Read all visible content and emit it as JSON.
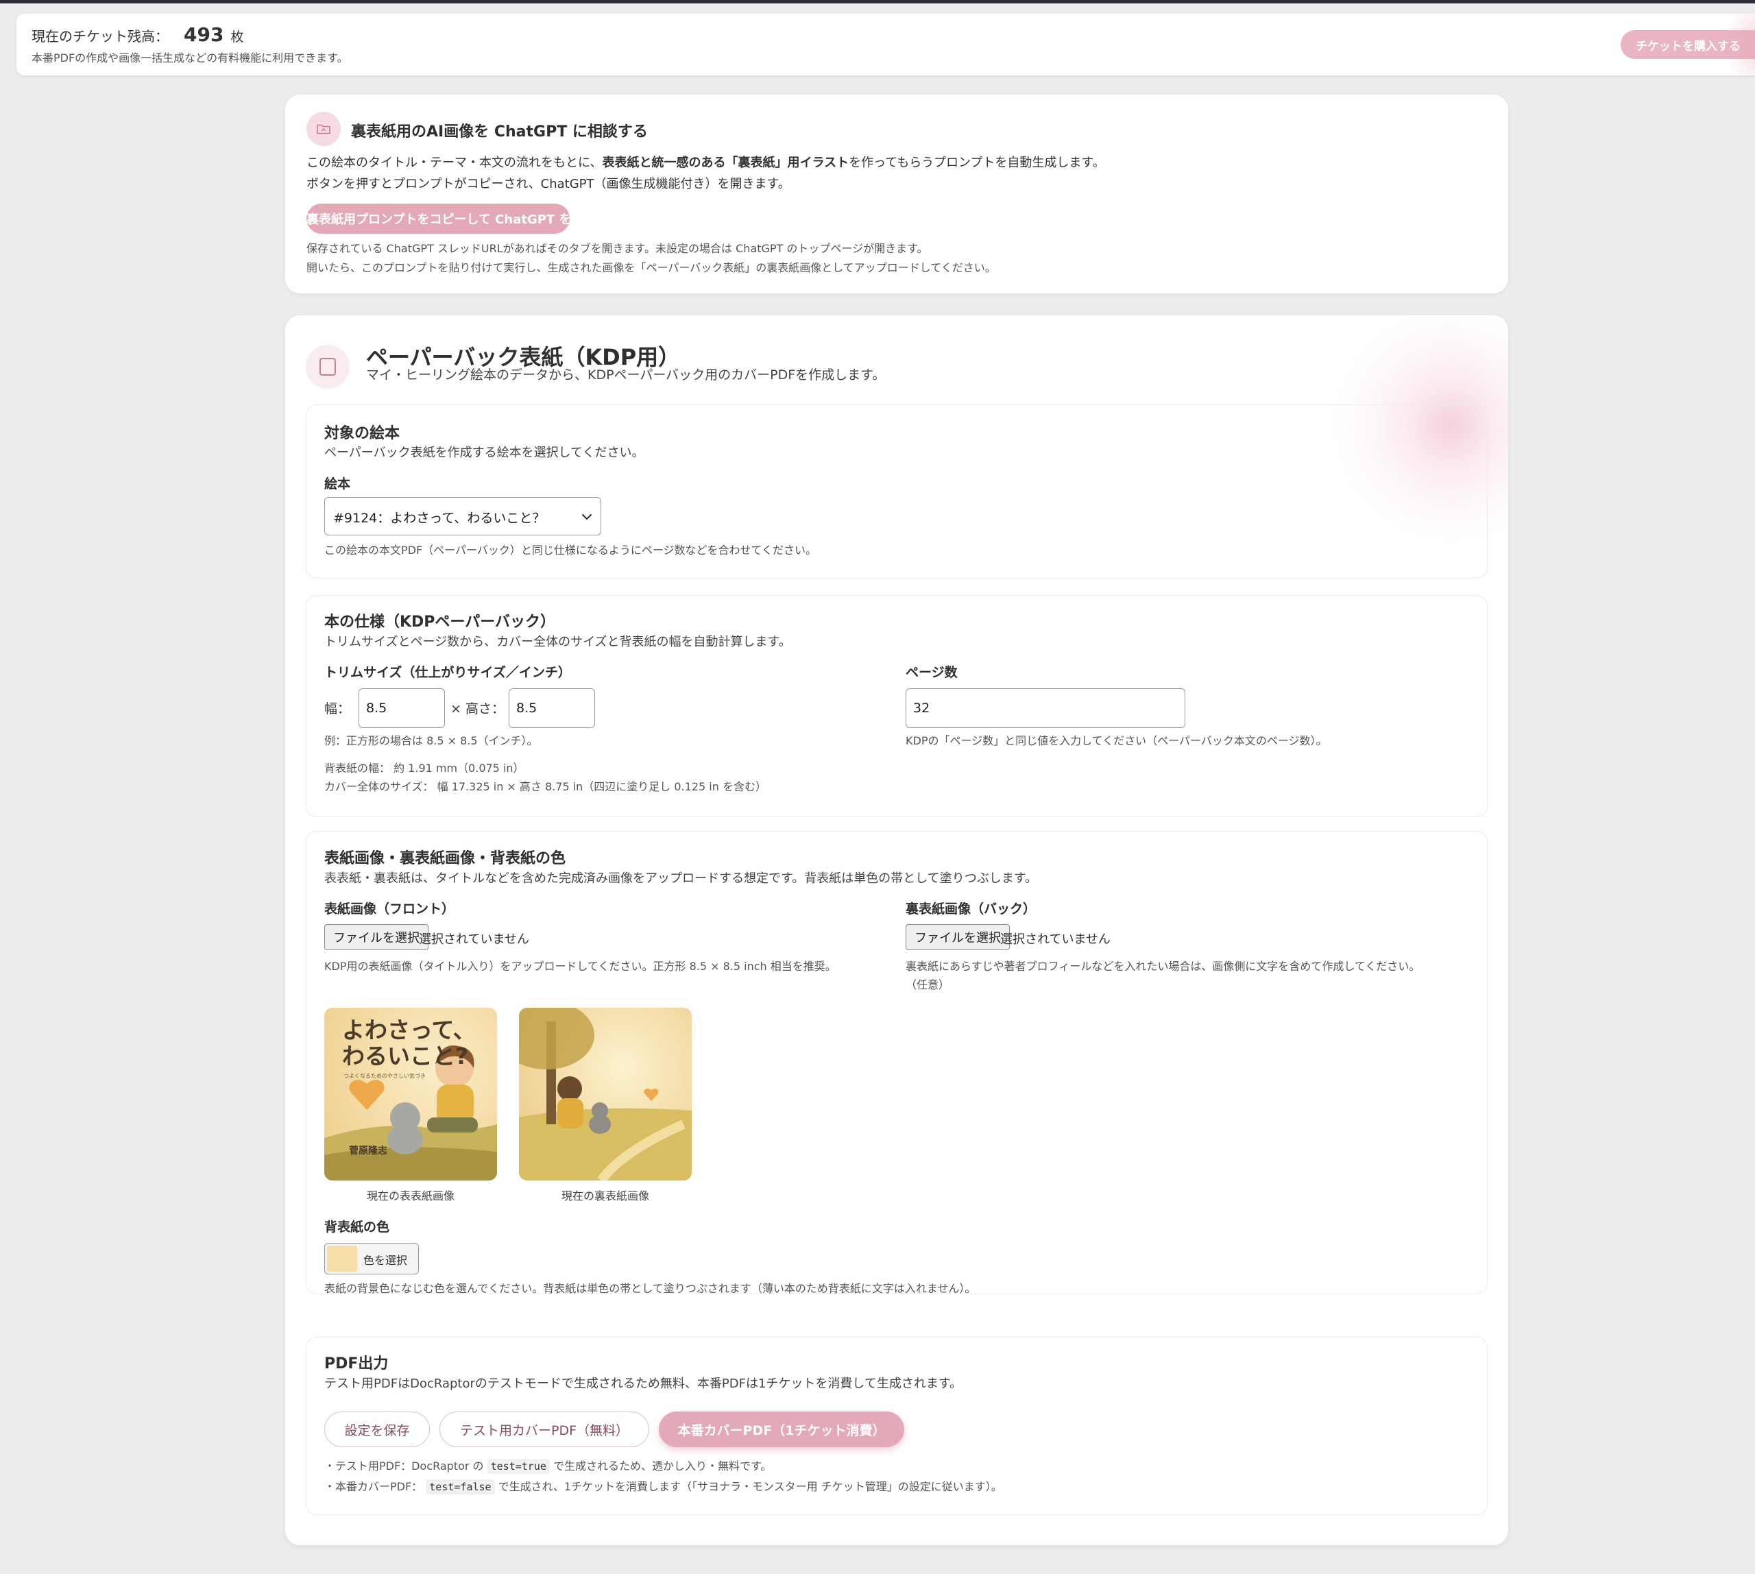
{
  "ticket": {
    "label": "現在のチケット残高：",
    "count": "493",
    "unit": "枚",
    "description": "本番PDFの作成や画像一括生成などの有料機能に利用できます。",
    "buy_button": "チケットを購入する"
  },
  "ai_card": {
    "icon": "folder-image-icon",
    "title": "裏表紙用のAI画像を ChatGPT に相談する",
    "desc_1a": "この絵本のタイトル・テーマ・本文の流れをもとに、",
    "desc_1b": "表表紙と統一感のある「裏表紙」用イラスト",
    "desc_1c": "を作ってもらうプロンプトを自動生成します。",
    "desc_2": "ボタンを押すとプロンプトがコピーされ、ChatGPT（画像生成機能付き）を開きます。",
    "button": "裏表紙用プロンプトをコピーして ChatGPT を開く",
    "note_1": "保存されている ChatGPT スレッドURLがあればそのタブを開きます。未設定の場合は ChatGPT のトップページが開きます。",
    "note_2": "開いたら、このプロンプトを貼り付けて実行し、生成された画像を「ペーパーバック表紙」の裏表紙画像としてアップロードしてください。"
  },
  "main": {
    "icon": "square-icon",
    "title": "ペーパーバック表紙（KDP用）",
    "subtitle": "マイ・ヒーリング絵本のデータから、KDPペーパーバック用のカバーPDFを作成します。"
  },
  "target_book": {
    "title": "対象の絵本",
    "desc": "ペーパーバック表紙を作成する絵本を選択してください。",
    "label": "絵本",
    "selected": "#9124：よわさって、わるいこと？",
    "hint": "この絵本の本文PDF（ペーパーバック）と同じ仕様になるようにページ数などを合わせてください。"
  },
  "spec": {
    "title": "本の仕様（KDPペーパーバック）",
    "desc": "トリムサイズとページ数から、カバー全体のサイズと背表紙の幅を自動計算します。",
    "trim_label": "トリムサイズ（仕上がりサイズ／インチ）",
    "width_label": "幅：",
    "width_value": "8.5",
    "times_height_label": "× 高さ：",
    "height_value": "8.5",
    "trim_hint": "例：正方形の場合は 8.5 × 8.5（インチ）。",
    "spine_width": "背表紙の幅： 約 1.91 mm（0.075 in）",
    "cover_size": "カバー全体のサイズ： 幅 17.325 in × 高さ 8.75 in（四辺に塗り足し 0.125 in を含む）",
    "pages_label": "ページ数",
    "pages_value": "32",
    "pages_hint": "KDPの「ページ数」と同じ値を入力してください（ペーパーバック本文のページ数）。"
  },
  "images": {
    "title": "表紙画像・裏表紙画像・背表紙の色",
    "desc": "表表紙・裏表紙は、タイトルなどを含めた完成済み画像をアップロードする想定です。背表紙は単色の帯として塗りつぶします。",
    "front_label": "表紙画像（フロント）",
    "front_button": "ファイルを選択",
    "front_status": "選択されていません",
    "front_hint": "KDP用の表紙画像（タイトル入り）をアップロードしてください。正方形 8.5 × 8.5 inch 相当を推奨。",
    "back_label": "裏表紙画像（バック）",
    "back_button": "ファイルを選択",
    "back_status": "選択されていません",
    "back_hint_1": "裏表紙にあらすじや著者プロフィールなどを入れたい場合は、画像側に文字を含めて作成してください。",
    "back_hint_2": "（任意）",
    "front_thumb_caption": "現在の表表紙画像",
    "back_thumb_caption": "現在の裏表紙画像",
    "cover_title_line1": "よわさって、",
    "cover_title_line2": "わるいこと?",
    "cover_subtitle": "つよくなるためのやさしい気づき",
    "cover_author": "菅原隆志",
    "spine_label": "背表紙の色",
    "color_button": "色を選択",
    "spine_color": "#f5dfa6",
    "spine_hint": "表紙の背景色になじむ色を選んでください。背表紙は単色の帯として塗りつぶされます（薄い本のため背表紙に文字は入れません）。"
  },
  "pdf": {
    "title": "PDF出力",
    "desc": "テスト用PDFはDocRaptorのテストモードで生成されるため無料、本番PDFは1チケットを消費して生成されます。",
    "save_button": "設定を保存",
    "test_button": "テスト用カバーPDF（無料）",
    "prod_button": "本番カバーPDF（1チケット消費）",
    "note1_a": "・テスト用PDF：DocRaptor の ",
    "note1_code": "test=true",
    "note1_b": " で生成されるため、透かし入り・無料です。",
    "note2_a": "・本番カバーPDF： ",
    "note2_code": "test=false",
    "note2_b": " で生成され、1チケットを消費します（「サヨナラ・モンスター用 チケット管理」の設定に従います）。"
  },
  "colors": {
    "accent": "#e3a9b7",
    "accent_light": "#f6dbe2",
    "background": "#ededed"
  }
}
